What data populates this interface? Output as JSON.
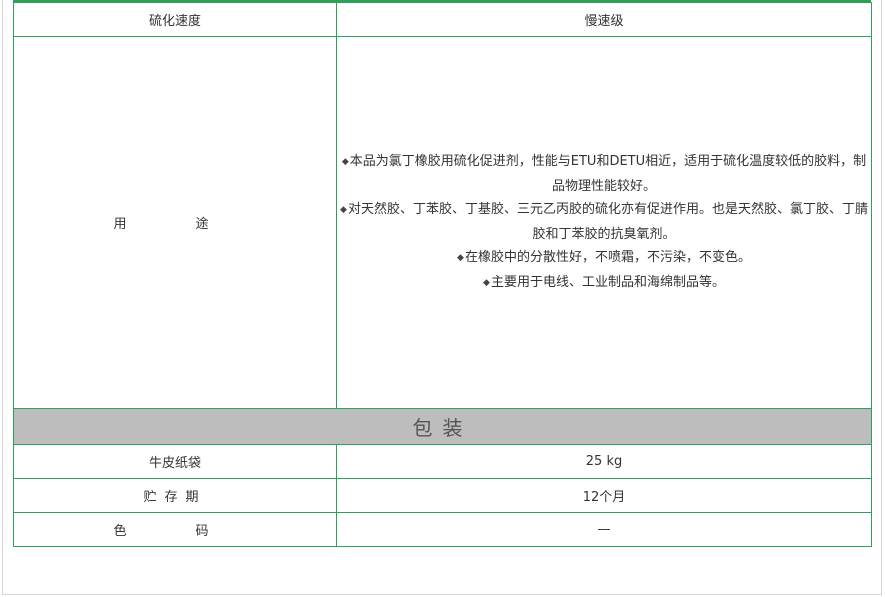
{
  "rows": {
    "speed": {
      "label": "硫化速度",
      "value": "慢速级"
    },
    "usage": {
      "label": "用　途",
      "bullet": "◆",
      "items": [
        "本品为氯丁橡胶用硫化促进剂，性能与ETU和DETU相近，适用于硫化温度较低的胶料，制品物理性能较好。",
        "对天然胶、丁苯胶、丁基胶、三元乙丙胶的硫化亦有促进作用。也是天然胶、氯丁胶、丁腈胶和丁苯胶的抗臭氧剂。",
        "在橡胶中的分散性好，不喷霜，不污染，不变色。",
        "主要用于电线、工业制品和海绵制品等。"
      ]
    },
    "packaging_header": "包装",
    "bag": {
      "label": "牛皮纸袋",
      "value": "25 kg"
    },
    "storage": {
      "label": "贮存期",
      "value": "12个月"
    },
    "color": {
      "label": "色　码",
      "value": "—"
    }
  },
  "colors": {
    "border": "#2fa05a",
    "header_bg": "#bdbdbd"
  }
}
